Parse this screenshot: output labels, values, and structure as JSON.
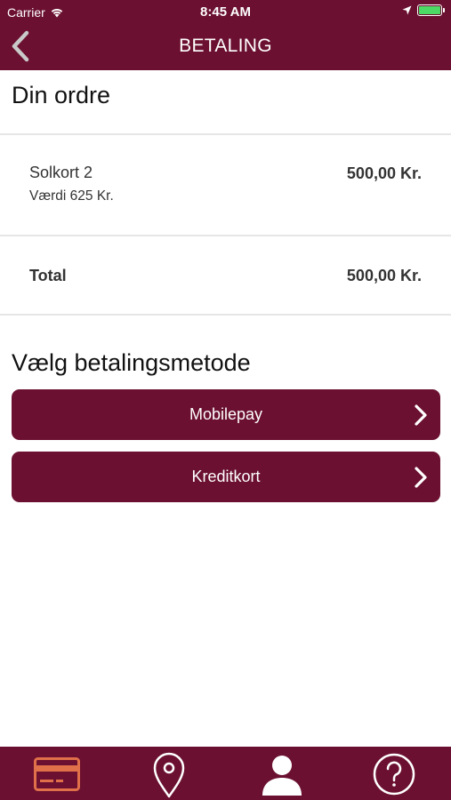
{
  "status_bar": {
    "carrier": "Carrier",
    "time": "8:45 AM",
    "battery_level": 1.0
  },
  "nav": {
    "title": "BETALING",
    "back_icon": "chevron-left-icon"
  },
  "order": {
    "heading": "Din ordre",
    "items": [
      {
        "name": "Solkort 2",
        "detail": "Værdi 625 Kr.",
        "price": "500,00 Kr."
      }
    ],
    "total_label": "Total",
    "total_value": "500,00 Kr."
  },
  "payment": {
    "heading": "Vælg betalingsmetode",
    "methods": [
      {
        "label": "Mobilepay",
        "icon": "chevron-right-icon"
      },
      {
        "label": "Kreditkort",
        "icon": "chevron-right-icon"
      }
    ]
  },
  "tab_bar": {
    "tabs": [
      {
        "icon": "credit-card-icon",
        "active": true
      },
      {
        "icon": "location-pin-icon",
        "active": false
      },
      {
        "icon": "user-icon",
        "active": false
      },
      {
        "icon": "help-icon",
        "active": false
      }
    ]
  },
  "colors": {
    "brand": "#6b1030",
    "active_tab": "#e0704a",
    "text": "#333333",
    "divider": "#e6e6e6",
    "battery": "#4cd964"
  }
}
